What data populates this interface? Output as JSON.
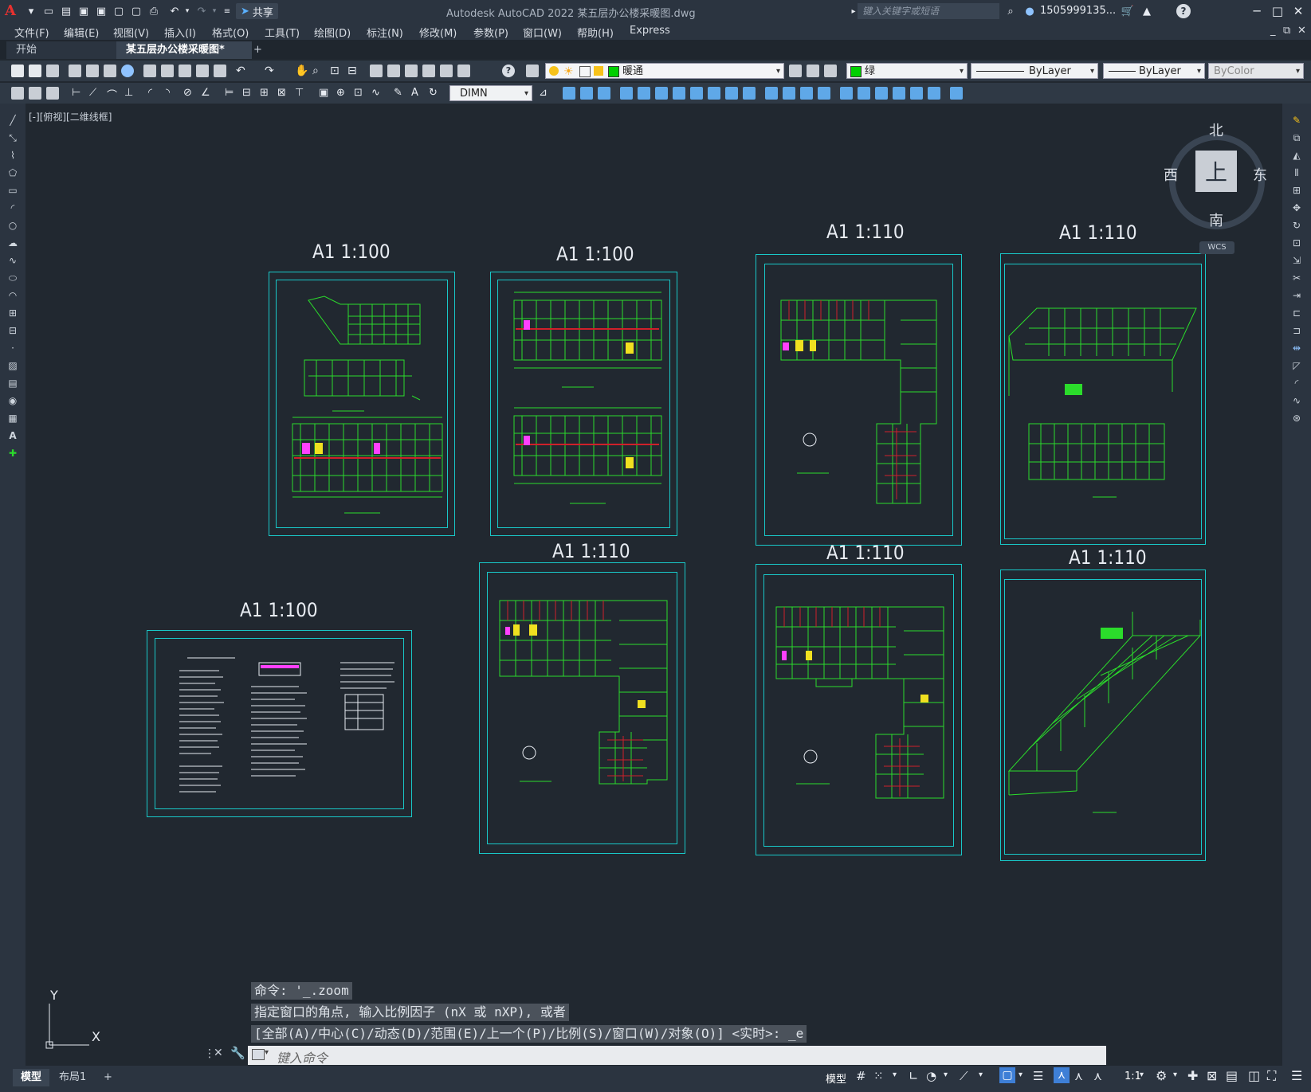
{
  "titlebar": {
    "app_logo": "A",
    "share_label": "共享",
    "window_title": "Autodesk AutoCAD 2022    某五层办公楼采暖图.dwg",
    "search_placeholder": "键入关键字或短语",
    "user_name": "1505999135...",
    "help_label": "?"
  },
  "menubar": {
    "items": [
      "文件(F)",
      "编辑(E)",
      "视图(V)",
      "插入(I)",
      "格式(O)",
      "工具(T)",
      "绘图(D)",
      "标注(N)",
      "修改(M)",
      "参数(P)",
      "窗口(W)",
      "帮助(H)",
      "Express"
    ]
  },
  "tabs": {
    "start": "开始",
    "drawing": "某五层办公楼采暖图*",
    "add": "+"
  },
  "toolbar": {
    "layer_name": "暖通",
    "color_name": "绿",
    "linetype": "ByLayer",
    "lineweight": "ByLayer",
    "plotstyle": "ByColor",
    "dimstyle": "DIMN"
  },
  "viewport": {
    "label": "[-][俯视][二维线框]"
  },
  "compass": {
    "north": "北",
    "south": "南",
    "east": "东",
    "west": "西",
    "top": "上",
    "wcs": "WCS"
  },
  "sheets": [
    {
      "title": "A1 1:100"
    },
    {
      "title": "A1 1:100"
    },
    {
      "title": "A1 1:110"
    },
    {
      "title": "A1 1:110"
    },
    {
      "title": "A1 1:100"
    },
    {
      "title": "A1 1:110"
    },
    {
      "title": "A1 1:110"
    },
    {
      "title": "A1 1:110"
    }
  ],
  "ucs": {
    "x": "X",
    "y": "Y"
  },
  "command": {
    "history": [
      "命令: '_.zoom",
      "指定窗口的角点, 输入比例因子 (nX 或 nXP), 或者",
      "[全部(A)/中心(C)/动态(D)/范围(E)/上一个(P)/比例(S)/窗口(W)/对象(O)] <实时>: _e"
    ],
    "placeholder": "键入命令"
  },
  "statusbar": {
    "layout_tabs": [
      "模型",
      "布局1"
    ],
    "add_layout": "+",
    "model_label": "模型",
    "scale_label": "1:1"
  },
  "colors": {
    "accent_cyan": "#19c8c8",
    "drawing_green": "#2bdc2b",
    "drawing_red": "#d0202a",
    "background": "#212830"
  }
}
